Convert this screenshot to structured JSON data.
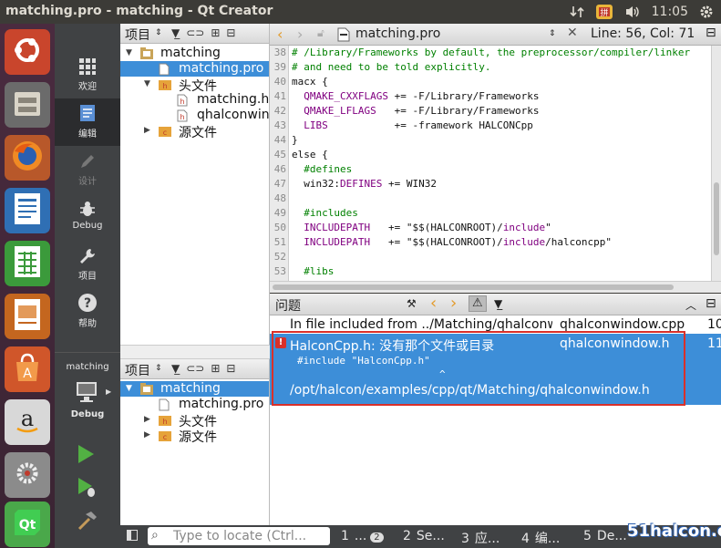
{
  "window": {
    "title": "matching.pro - matching - Qt Creator",
    "clock": "11:05"
  },
  "modes": [
    {
      "label": "欢迎",
      "icon": "grid-icon"
    },
    {
      "label": "编辑",
      "icon": "edit-icon"
    },
    {
      "label": "设计",
      "icon": "pencil-icon"
    },
    {
      "label": "Debug",
      "icon": "bug-icon"
    },
    {
      "label": "项目",
      "icon": "wrench-icon"
    },
    {
      "label": "帮助",
      "icon": "help-icon"
    }
  ],
  "kit": {
    "project": "matching",
    "build": "Debug"
  },
  "project_pane": {
    "header": "项目",
    "tree": [
      {
        "label": "matching",
        "depth": 0,
        "arrow": "▼",
        "icon": "folder"
      },
      {
        "label": "matching.pro",
        "depth": 1,
        "arrow": "",
        "icon": "file",
        "selected": true
      },
      {
        "label": "头文件",
        "depth": 1,
        "arrow": "▼",
        "icon": "hfolder"
      },
      {
        "label": "matching.h",
        "depth": 2,
        "arrow": "",
        "icon": "hfile"
      },
      {
        "label": "qhalconwind",
        "depth": 2,
        "arrow": "",
        "icon": "hfile"
      },
      {
        "label": "源文件",
        "depth": 1,
        "arrow": "▶",
        "icon": "cfolder"
      }
    ]
  },
  "project_pane2": {
    "header": "项目",
    "tree": [
      {
        "label": "matching",
        "depth": 0,
        "arrow": "▼",
        "icon": "folder",
        "selected": true
      },
      {
        "label": "matching.pro",
        "depth": 1,
        "arrow": "",
        "icon": "file"
      },
      {
        "label": "头文件",
        "depth": 1,
        "arrow": "▶",
        "icon": "hfolder"
      },
      {
        "label": "源文件",
        "depth": 1,
        "arrow": "▶",
        "icon": "cfolder"
      }
    ]
  },
  "editor": {
    "filename": "matching.pro",
    "position": "Line: 56, Col: 71",
    "lines": [
      {
        "n": "38",
        "parts": [
          {
            "t": "# /Library/Frameworks by default, the preprocessor/compiler/linker",
            "c": "cm"
          }
        ]
      },
      {
        "n": "39",
        "parts": [
          {
            "t": "# and need to be told explicitly.",
            "c": "cm"
          }
        ]
      },
      {
        "n": "40",
        "parts": [
          {
            "t": "macx {",
            "c": ""
          }
        ]
      },
      {
        "n": "41",
        "parts": [
          {
            "t": "  ",
            "c": ""
          },
          {
            "t": "QMAKE_CXXFLAGS",
            "c": "kw"
          },
          {
            "t": " += -F/Library/Frameworks",
            "c": ""
          }
        ]
      },
      {
        "n": "42",
        "parts": [
          {
            "t": "  ",
            "c": ""
          },
          {
            "t": "QMAKE_LFLAGS",
            "c": "kw"
          },
          {
            "t": "   += -F/Library/Frameworks",
            "c": ""
          }
        ]
      },
      {
        "n": "43",
        "parts": [
          {
            "t": "  ",
            "c": ""
          },
          {
            "t": "LIBS",
            "c": "kw"
          },
          {
            "t": "           += -framework HALCONCpp",
            "c": ""
          }
        ]
      },
      {
        "n": "44",
        "parts": [
          {
            "t": "}",
            "c": ""
          }
        ]
      },
      {
        "n": "45",
        "parts": [
          {
            "t": "else {",
            "c": ""
          }
        ]
      },
      {
        "n": "46",
        "parts": [
          {
            "t": "  #defines",
            "c": "cm"
          }
        ]
      },
      {
        "n": "47",
        "parts": [
          {
            "t": "  win32:",
            "c": ""
          },
          {
            "t": "DEFINES",
            "c": "kw"
          },
          {
            "t": " += WIN32",
            "c": ""
          }
        ]
      },
      {
        "n": "48",
        "parts": [
          {
            "t": "",
            "c": ""
          }
        ]
      },
      {
        "n": "49",
        "parts": [
          {
            "t": "  #includes",
            "c": "cm"
          }
        ]
      },
      {
        "n": "50",
        "parts": [
          {
            "t": "  ",
            "c": ""
          },
          {
            "t": "INCLUDEPATH",
            "c": "kw"
          },
          {
            "t": "   += \"$$(HALCONROOT)/",
            "c": ""
          },
          {
            "t": "include",
            "c": "kw"
          },
          {
            "t": "\"",
            "c": ""
          }
        ]
      },
      {
        "n": "51",
        "parts": [
          {
            "t": "  ",
            "c": ""
          },
          {
            "t": "INCLUDEPATH",
            "c": "kw"
          },
          {
            "t": "   += \"$$(HALCONROOT)/",
            "c": ""
          },
          {
            "t": "include",
            "c": "kw"
          },
          {
            "t": "/halconcpp\"",
            "c": ""
          }
        ]
      },
      {
        "n": "52",
        "parts": [
          {
            "t": "",
            "c": ""
          }
        ]
      },
      {
        "n": "53",
        "parts": [
          {
            "t": "  #libs",
            "c": "cm"
          }
        ]
      }
    ]
  },
  "issues": {
    "header": "问题",
    "rows": [
      {
        "text": "In file included from ../Matching/qhalconw",
        "file": "qhalconwindow.cpp",
        "line": "10"
      },
      {
        "text": "HalconCpp.h: 没有那个文件或目录",
        "file": "qhalconwindow.h",
        "line": "11",
        "detail1": "#include \"HalconCpp.h\"",
        "detail2": "^",
        "detail3": "/opt/halcon/examples/cpp/qt/Matching/qhalconwindow.h"
      }
    ]
  },
  "statusbar": {
    "locator_placeholder": "Type to locate (Ctrl...",
    "tabs": [
      {
        "num": "1",
        "label": "...",
        "badge": "2"
      },
      {
        "num": "2",
        "label": "Se..."
      },
      {
        "num": "3",
        "label": "应..."
      },
      {
        "num": "4",
        "label": "编..."
      },
      {
        "num": "5",
        "label": "De..."
      }
    ]
  },
  "watermark": "51halcon.com",
  "colors": {
    "selection": "#3d8ed8",
    "error_border": "#d9302a"
  }
}
